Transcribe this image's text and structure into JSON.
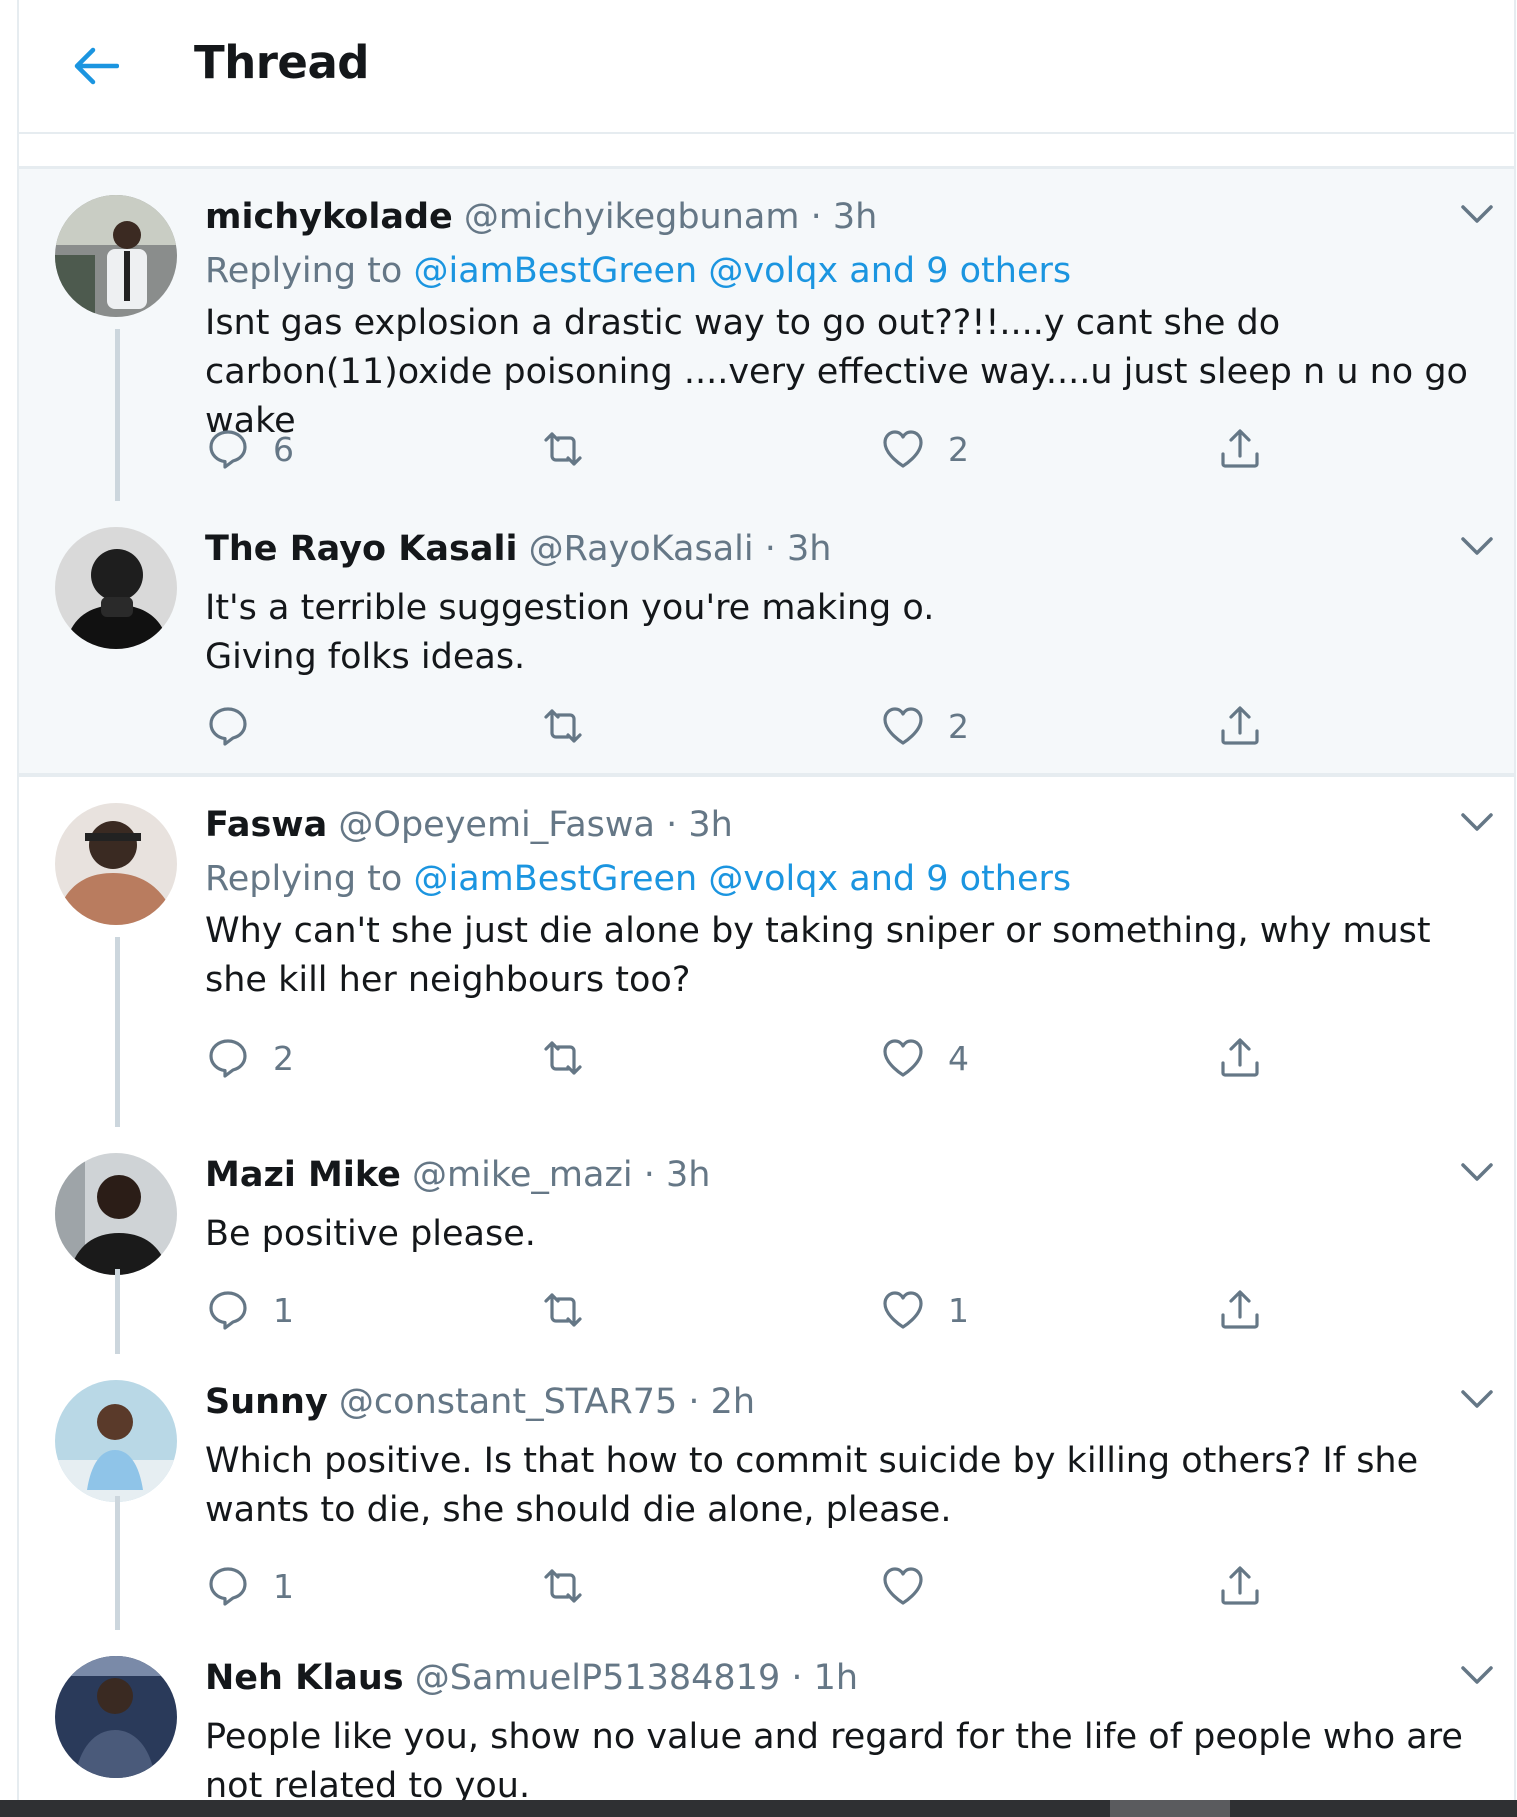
{
  "header": {
    "title": "Thread"
  },
  "tweets": [
    {
      "name": "michykolade",
      "handle": "@michyikegbunam",
      "time": "3h",
      "replying_label": "Replying to",
      "replying_to": "@iamBestGreen @volqx and 9 others",
      "text": "Isnt gas explosion a drastic way to go out??!!....y cant she do carbon(11)oxide poisoning ....very effective way....u just sleep n u no go wake",
      "replies": "6",
      "retweets": "",
      "likes": "2"
    },
    {
      "name": "The Rayo Kasali",
      "handle": "@RayoKasali",
      "time": "3h",
      "text": "It's a terrible suggestion you're making o.\nGiving folks ideas.",
      "replies": "",
      "retweets": "",
      "likes": "2"
    },
    {
      "name": "Faswa",
      "handle": "@Opeyemi_Faswa",
      "time": "3h",
      "replying_label": "Replying to",
      "replying_to": "@iamBestGreen @volqx and 9 others",
      "text": "Why can't she just die alone by taking sniper or something, why must she kill her neighbours too?",
      "replies": "2",
      "retweets": "",
      "likes": "4"
    },
    {
      "name": "Mazi Mike",
      "handle": "@mike_mazi",
      "time": "3h",
      "text": "Be positive please.",
      "replies": "1",
      "retweets": "",
      "likes": "1"
    },
    {
      "name": "Sunny",
      "handle": "@constant_STAR75",
      "time": "2h",
      "text": "Which positive. Is that how to commit suicide by killing others? If she wants to die, she should die alone, please.",
      "replies": "1",
      "retweets": "",
      "likes": ""
    },
    {
      "name": "Neh Klaus",
      "handle": "@SamuelP51384819",
      "time": "1h",
      "text": "People like you, show no value and regard for the life of people who are not related to you."
    }
  ],
  "colors": {
    "accent": "#1b95e0",
    "secondary_text": "#657786",
    "thread_line": "#ccd6dd",
    "highlight_bg": "#f5f8fa"
  },
  "icons": [
    "back-arrow-icon",
    "chevron-down-icon",
    "reply-icon",
    "retweet-icon",
    "like-icon",
    "share-icon"
  ]
}
